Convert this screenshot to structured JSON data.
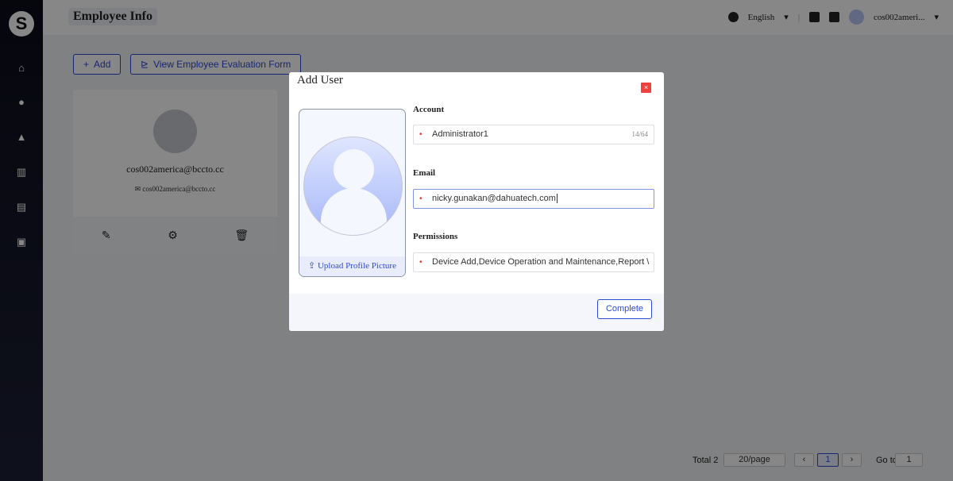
{
  "header": {
    "title": "Employee Info",
    "language": "English",
    "user": "cos002ameri..."
  },
  "toolbar": {
    "add_label": "Add",
    "evaluation_label": "View Employee Evaluation Form"
  },
  "card": {
    "name": "cos002america@bccto.cc",
    "email": "cos002america@bccto.cc"
  },
  "pagination": {
    "total": "Total 2",
    "page_size": "20/page",
    "current_page": "1",
    "goto_label": "Go to",
    "goto_value": "1"
  },
  "modal": {
    "title": "Add User",
    "close": "×",
    "upload_label": "Upload Profile Picture",
    "account_label": "Account",
    "account_value": "Administrator1",
    "account_count": "14/64",
    "email_label": "Email",
    "email_value": "nicky.gunakan@dahuatech.com",
    "permissions_label": "Permissions",
    "permissions_value": "Device Add,Device Operation and Maintenance,Report \\",
    "complete_label": "Complete"
  },
  "colors": {
    "accent": "#2a4ad8",
    "close": "#f04040",
    "sidebar": "#0f1120"
  }
}
